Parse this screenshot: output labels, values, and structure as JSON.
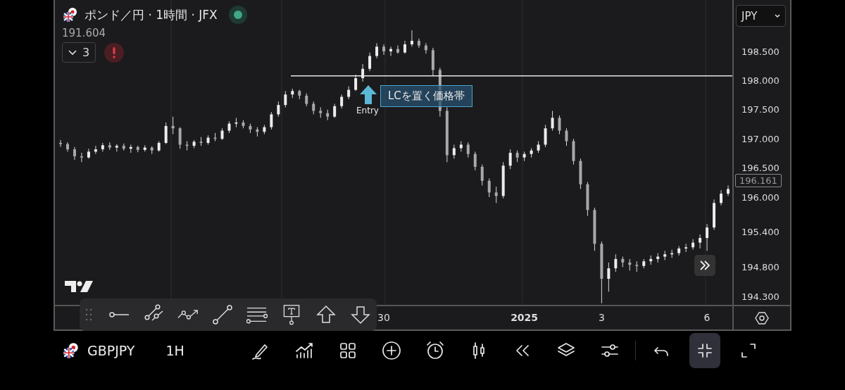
{
  "legend": {
    "title": "ポンド／円 · 1時間 · JFX",
    "market_open": true,
    "price": "191.604",
    "indicators_count": "3"
  },
  "chart": {
    "currency": "JPY",
    "current_price": "196.161",
    "time_labels": [
      {
        "label": "30",
        "emphasis": false
      },
      {
        "label": "2025",
        "emphasis": true
      },
      {
        "label": "3",
        "emphasis": false
      },
      {
        "label": "6",
        "emphasis": false
      }
    ],
    "entry_label": "Entry",
    "callout": "LCを置く価格帯",
    "chart_data": {
      "type": "candlestick",
      "categories": [
        null,
        null,
        null,
        null,
        null,
        null,
        null,
        null,
        null,
        null,
        null,
        null,
        null,
        null,
        null,
        null,
        null,
        null,
        null,
        null,
        null,
        null,
        null,
        null,
        null,
        null,
        null,
        null,
        null,
        null,
        null,
        null,
        null,
        null,
        null,
        null,
        null,
        null,
        null,
        null,
        null,
        null,
        null,
        null,
        null,
        null,
        null,
        null,
        null,
        null,
        null,
        null,
        null,
        null,
        null,
        null,
        null,
        null,
        null,
        null,
        null,
        null,
        null,
        null,
        null,
        null,
        null,
        null,
        null,
        null,
        null,
        null,
        null,
        null,
        null,
        null,
        null,
        null,
        null,
        null,
        null,
        null,
        null,
        null,
        null,
        null,
        null,
        null,
        null,
        null,
        null,
        null,
        null,
        null,
        null,
        null
      ],
      "ylim": [
        194.15,
        199.4
      ],
      "ref_lines": [
        {
          "axis": "y",
          "value": 198.1
        }
      ],
      "yticks": [
        {
          "value": 198.5,
          "label": "198.500"
        },
        {
          "value": 198,
          "label": "198.000"
        },
        {
          "value": 197.5,
          "label": "197.500"
        },
        {
          "value": 197,
          "label": "197.000"
        },
        {
          "value": 196.5,
          "label": "196.500"
        },
        {
          "value": 196,
          "label": "196.000"
        },
        {
          "value": 195.4,
          "label": "195.400"
        },
        {
          "value": 194.8,
          "label": "194.800"
        },
        {
          "value": 194.3,
          "label": "194.300"
        }
      ],
      "ohlc": [
        [
          196.95,
          197.0,
          196.88,
          196.93
        ],
        [
          196.93,
          196.96,
          196.8,
          196.84
        ],
        [
          196.84,
          196.88,
          196.66,
          196.72
        ],
        [
          196.72,
          196.78,
          196.62,
          196.7
        ],
        [
          196.7,
          196.85,
          196.68,
          196.8
        ],
        [
          196.8,
          196.9,
          196.76,
          196.84
        ],
        [
          196.84,
          196.95,
          196.8,
          196.91
        ],
        [
          196.91,
          196.96,
          196.83,
          196.87
        ],
        [
          196.87,
          196.93,
          196.8,
          196.9
        ],
        [
          196.9,
          196.94,
          196.82,
          196.85
        ],
        [
          196.85,
          196.92,
          196.78,
          196.88
        ],
        [
          196.88,
          196.9,
          196.79,
          196.83
        ],
        [
          196.83,
          196.91,
          196.8,
          196.87
        ],
        [
          196.87,
          196.89,
          196.76,
          196.82
        ],
        [
          196.82,
          196.98,
          196.8,
          196.95
        ],
        [
          196.95,
          197.3,
          196.93,
          197.24
        ],
        [
          197.24,
          197.4,
          197.1,
          197.2
        ],
        [
          197.2,
          197.22,
          196.85,
          196.92
        ],
        [
          196.92,
          196.98,
          196.82,
          196.9
        ],
        [
          196.9,
          197.0,
          196.86,
          196.97
        ],
        [
          196.97,
          197.05,
          196.9,
          196.95
        ],
        [
          196.95,
          197.08,
          196.92,
          197.04
        ],
        [
          197.04,
          197.12,
          196.98,
          197.02
        ],
        [
          197.02,
          197.2,
          197.0,
          197.16
        ],
        [
          197.16,
          197.32,
          197.12,
          197.28
        ],
        [
          197.28,
          197.38,
          197.22,
          197.3
        ],
        [
          197.3,
          197.34,
          197.2,
          197.24
        ],
        [
          197.24,
          197.28,
          197.12,
          197.18
        ],
        [
          197.18,
          197.22,
          197.06,
          197.14
        ],
        [
          197.14,
          197.26,
          197.1,
          197.22
        ],
        [
          197.22,
          197.48,
          197.18,
          197.44
        ],
        [
          197.44,
          197.66,
          197.4,
          197.6
        ],
        [
          197.6,
          197.84,
          197.56,
          197.78
        ],
        [
          197.78,
          197.88,
          197.72,
          197.84
        ],
        [
          197.84,
          197.86,
          197.7,
          197.76
        ],
        [
          197.76,
          197.8,
          197.58,
          197.62
        ],
        [
          197.62,
          197.66,
          197.44,
          197.5
        ],
        [
          197.5,
          197.56,
          197.38,
          197.46
        ],
        [
          197.46,
          197.52,
          197.34,
          197.4
        ],
        [
          197.4,
          197.62,
          197.38,
          197.58
        ],
        [
          197.58,
          197.78,
          197.54,
          197.74
        ],
        [
          197.74,
          197.92,
          197.7,
          197.86
        ],
        [
          197.86,
          198.12,
          197.84,
          198.06
        ],
        [
          198.06,
          198.3,
          198.0,
          198.22
        ],
        [
          198.22,
          198.5,
          198.18,
          198.44
        ],
        [
          198.44,
          198.66,
          198.4,
          198.6
        ],
        [
          198.6,
          198.64,
          198.46,
          198.52
        ],
        [
          198.52,
          198.6,
          198.44,
          198.56
        ],
        [
          198.56,
          198.62,
          198.48,
          198.5
        ],
        [
          198.5,
          198.7,
          198.48,
          198.64
        ],
        [
          198.64,
          198.88,
          198.6,
          198.7
        ],
        [
          198.7,
          198.74,
          198.58,
          198.62
        ],
        [
          198.62,
          198.66,
          198.48,
          198.54
        ],
        [
          198.54,
          198.58,
          198.1,
          198.2
        ],
        [
          198.2,
          198.24,
          197.4,
          197.5
        ],
        [
          197.5,
          197.56,
          196.62,
          196.74
        ],
        [
          196.74,
          196.92,
          196.68,
          196.86
        ],
        [
          196.86,
          196.98,
          196.8,
          196.92
        ],
        [
          196.92,
          196.96,
          196.7,
          196.76
        ],
        [
          196.76,
          196.8,
          196.48,
          196.54
        ],
        [
          196.54,
          196.58,
          196.22,
          196.3
        ],
        [
          196.3,
          196.34,
          196.02,
          196.1
        ],
        [
          196.1,
          196.2,
          195.92,
          196.04
        ],
        [
          196.04,
          196.62,
          196.0,
          196.56
        ],
        [
          196.56,
          196.84,
          196.5,
          196.78
        ],
        [
          196.78,
          196.82,
          196.62,
          196.7
        ],
        [
          196.7,
          196.8,
          196.64,
          196.76
        ],
        [
          196.76,
          196.86,
          196.7,
          196.82
        ],
        [
          196.82,
          196.98,
          196.78,
          196.92
        ],
        [
          196.92,
          197.26,
          196.88,
          197.2
        ],
        [
          197.2,
          197.5,
          197.16,
          197.38
        ],
        [
          197.38,
          197.42,
          197.1,
          197.16
        ],
        [
          197.16,
          197.2,
          196.9,
          196.98
        ],
        [
          196.98,
          197.02,
          196.58,
          196.64
        ],
        [
          196.64,
          196.68,
          196.16,
          196.24
        ],
        [
          196.24,
          196.28,
          195.7,
          195.8
        ],
        [
          195.8,
          195.84,
          195.1,
          195.22
        ],
        [
          195.22,
          195.26,
          194.2,
          194.62
        ],
        [
          194.62,
          194.9,
          194.4,
          194.8
        ],
        [
          194.8,
          195.04,
          194.74,
          194.96
        ],
        [
          194.96,
          195.0,
          194.82,
          194.9
        ],
        [
          194.9,
          194.96,
          194.76,
          194.86
        ],
        [
          194.86,
          194.92,
          194.74,
          194.84
        ],
        [
          194.84,
          194.96,
          194.8,
          194.92
        ],
        [
          194.92,
          195.02,
          194.86,
          194.96
        ],
        [
          194.96,
          195.06,
          194.9,
          195.0
        ],
        [
          195.0,
          195.1,
          194.94,
          195.04
        ],
        [
          195.04,
          195.12,
          194.98,
          195.06
        ],
        [
          195.06,
          195.18,
          195.02,
          195.14
        ],
        [
          195.14,
          195.22,
          195.08,
          195.16
        ],
        [
          195.16,
          195.3,
          195.12,
          195.24
        ],
        [
          195.24,
          195.38,
          195.14,
          195.32
        ],
        [
          195.32,
          195.56,
          195.1,
          195.5
        ],
        [
          195.5,
          195.98,
          195.46,
          195.92
        ],
        [
          195.92,
          196.14,
          195.88,
          196.08
        ],
        [
          196.08,
          196.22,
          196.04,
          196.16
        ]
      ]
    }
  },
  "drawing_toolbar": [
    {
      "kind": "ray"
    },
    {
      "kind": "parallel"
    },
    {
      "kind": "path"
    },
    {
      "kind": "trend"
    },
    {
      "kind": "fib"
    },
    {
      "kind": "note"
    },
    {
      "kind": "up"
    },
    {
      "kind": "down"
    }
  ],
  "bottom_bar": {
    "symbol": "GBPJPY",
    "interval": "1H",
    "tools": [
      {
        "kind": "draw",
        "selected": false
      },
      {
        "kind": "indicators",
        "selected": false
      },
      {
        "kind": "layout",
        "selected": false
      },
      {
        "kind": "add",
        "selected": false
      },
      {
        "kind": "alert",
        "selected": false
      },
      {
        "kind": "chart_type",
        "selected": false
      },
      {
        "kind": "replay",
        "selected": false
      },
      {
        "kind": "layers",
        "selected": false
      },
      {
        "kind": "settings",
        "selected": false
      },
      {
        "kind": "divider",
        "selected": false
      },
      {
        "kind": "undo",
        "selected": false
      },
      {
        "kind": "collapse",
        "selected": true
      },
      {
        "kind": "expand",
        "selected": false
      }
    ]
  }
}
